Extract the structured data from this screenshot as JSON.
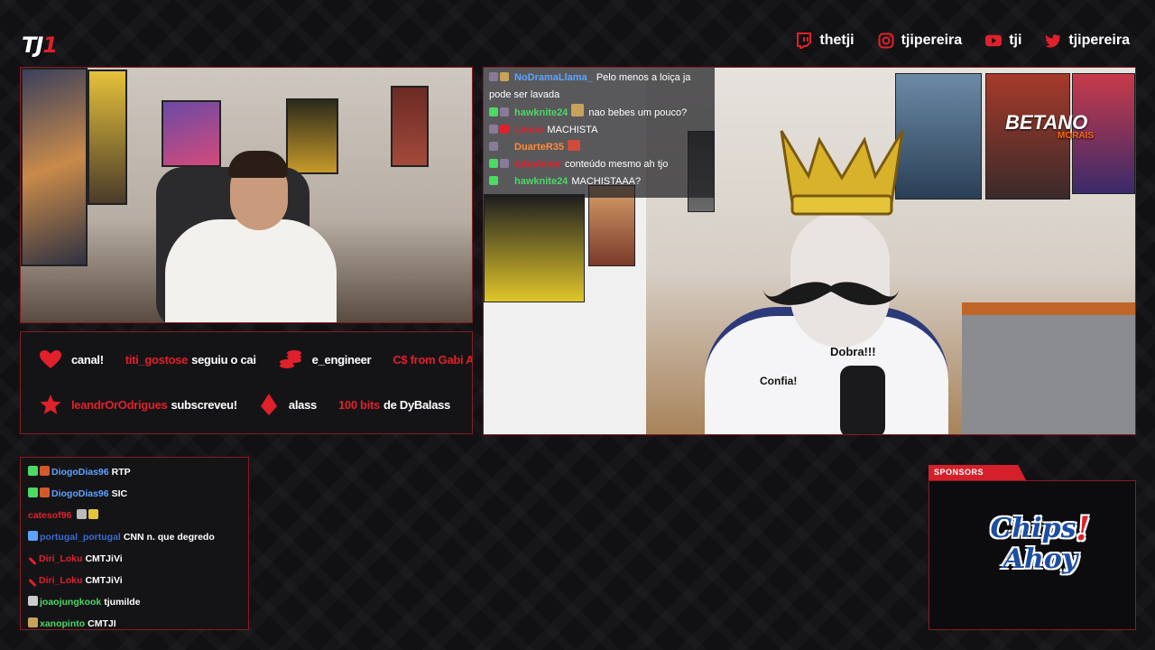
{
  "brand": {
    "logo_main": "TJ",
    "logo_accent": "1"
  },
  "socials": [
    {
      "icon": "twitch-icon",
      "handle": "thetji"
    },
    {
      "icon": "instagram-icon",
      "handle": "tjipereira"
    },
    {
      "icon": "youtube-icon",
      "handle": "tji"
    },
    {
      "icon": "twitter-icon",
      "handle": "tjipereira"
    }
  ],
  "alerts": {
    "row1": [
      {
        "text": "canal!",
        "color": "white"
      },
      {
        "text": "titi_gostose",
        "color": "red"
      },
      {
        "text": "seguiu o cai",
        "color": "white"
      },
      {
        "text": "e_engineer",
        "color": "white"
      },
      {
        "text": "C$ from Gabi Al",
        "color": "mixed"
      }
    ],
    "row2": [
      {
        "text": "leandrOrOdrigues",
        "color": "red"
      },
      {
        "text": "subscreveu!",
        "color": "white"
      },
      {
        "text": "alass",
        "color": "white"
      },
      {
        "text": "100 bits",
        "color": "red"
      },
      {
        "text": "de DyBalass",
        "color": "white"
      }
    ]
  },
  "scene_chat": [
    {
      "name": "NoDramaLlama_",
      "name_color": "#5da4ff",
      "text": "Pelo menos a loiça ja"
    },
    {
      "name": "",
      "name_color": "#ffffff",
      "text": "pode ser lavada"
    },
    {
      "name": "hawknite24",
      "name_color": "#4cd964",
      "text": "nao bebes um pouco?"
    },
    {
      "name": "Lenco",
      "name_color": "#e0202a",
      "text": "MACHISTA"
    },
    {
      "name": "DuarteR35",
      "name_color": "#ff8a3a",
      "text": ""
    },
    {
      "name": "tuba4ever",
      "name_color": "#e0202a",
      "text": "conteúdo mesmo ah tjo"
    },
    {
      "name": "hawknite24",
      "name_color": "#4cd964",
      "text": "MACHISTAAA?"
    }
  ],
  "scene": {
    "betano_text": "BETANO",
    "betano_sub": "MORAIS",
    "sticker_top": "Dobra!!!",
    "sticker_left": "Confia!"
  },
  "chat": [
    {
      "name": "DiogoDias96",
      "name_color": "#5da4ff",
      "msg": "RTP"
    },
    {
      "name": "DiogoDias96",
      "name_color": "#5da4ff",
      "msg": "SIC"
    },
    {
      "name": "catesof96",
      "name_color": "#e0202a",
      "msg": ""
    },
    {
      "name": "portugal_portugal",
      "name_color": "#3a6bd0",
      "msg": "CNN n. que degredo"
    },
    {
      "name": "Diri_Loku",
      "name_color": "#e0202a",
      "msg": "CMTJiVi"
    },
    {
      "name": "Diri_Loku",
      "name_color": "#e0202a",
      "msg": "CMTJiVi"
    },
    {
      "name": "joaojungkook",
      "name_color": "#4cd964",
      "msg": "tjumilde"
    },
    {
      "name": "xanopinto",
      "name_color": "#4cd964",
      "msg": "CMTJI"
    }
  ],
  "sponsors": {
    "label": "SPONSORS",
    "brand_line1": "Chips",
    "brand_line2": "Ahoy",
    "brand_bang": "!"
  },
  "colors": {
    "accent": "#e0202a",
    "border": "#8a1b20",
    "background": "#111114"
  }
}
